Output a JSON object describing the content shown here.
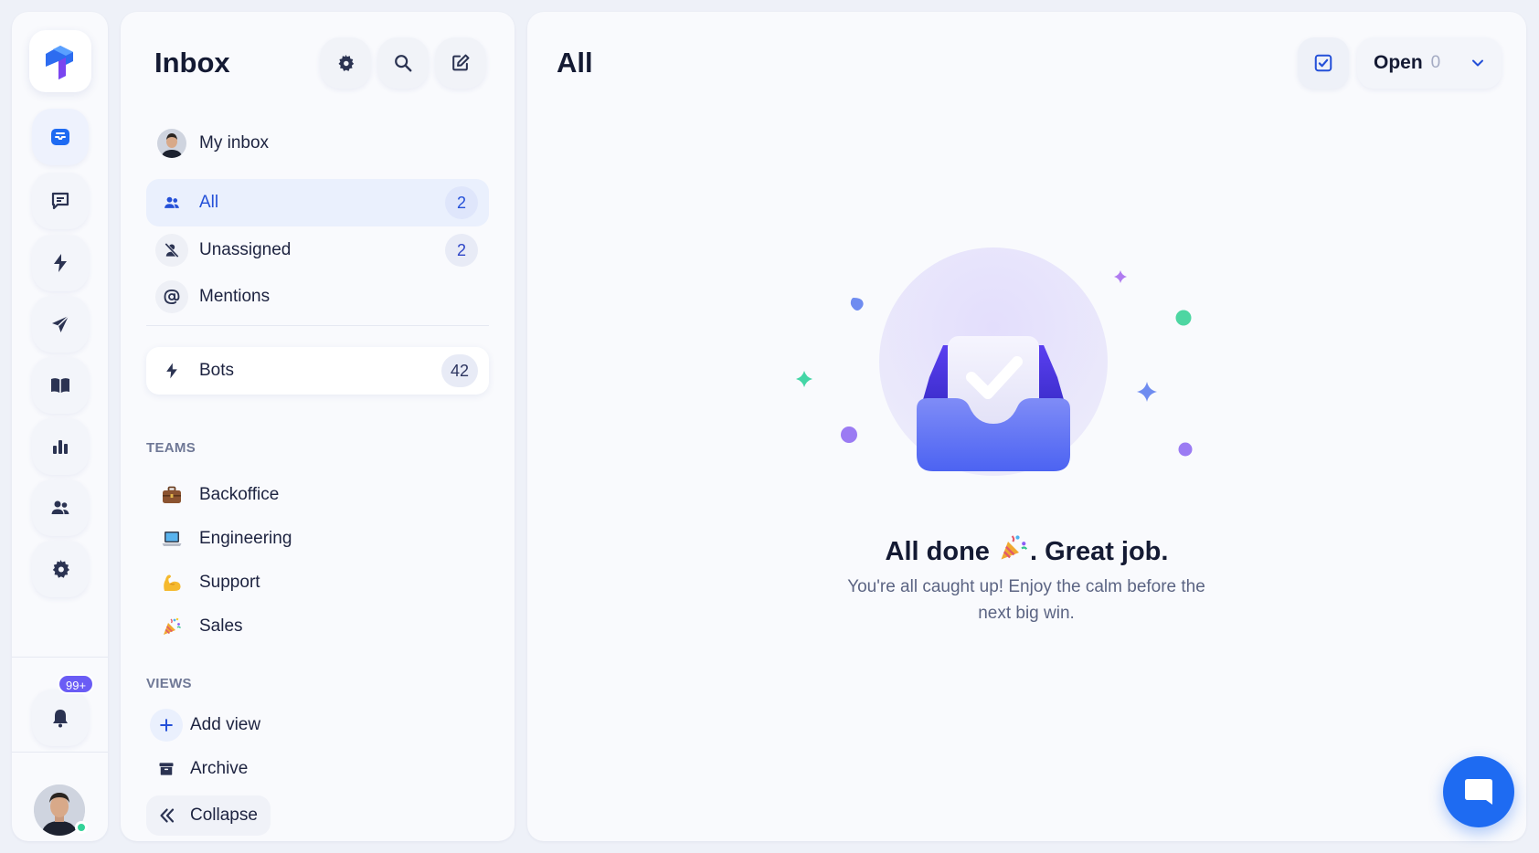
{
  "rail": {
    "items": [
      {
        "name": "inbox",
        "icon": "inbox-icon",
        "active": true
      },
      {
        "name": "chat",
        "icon": "chat-icon"
      },
      {
        "name": "automations",
        "icon": "lightning-icon"
      },
      {
        "name": "campaigns",
        "icon": "send-icon"
      },
      {
        "name": "knowledge-base",
        "icon": "book-icon"
      },
      {
        "name": "reports",
        "icon": "bar-chart-icon"
      },
      {
        "name": "contacts",
        "icon": "people-icon"
      },
      {
        "name": "settings",
        "icon": "gear-icon"
      }
    ],
    "notifications_badge": "99+"
  },
  "sidebar": {
    "title": "Inbox",
    "nav": [
      {
        "label": "My inbox",
        "count": ""
      },
      {
        "label": "All",
        "count": "2"
      },
      {
        "label": "Unassigned",
        "count": "2"
      },
      {
        "label": "Mentions",
        "count": ""
      },
      {
        "label": "Bots",
        "count": "42"
      }
    ],
    "teams_label": "TEAMS",
    "teams": [
      {
        "label": "Backoffice",
        "icon": "briefcase-icon"
      },
      {
        "label": "Engineering",
        "icon": "laptop-icon"
      },
      {
        "label": "Support",
        "icon": "flexed-biceps-icon"
      },
      {
        "label": "Sales",
        "icon": "party-popper-icon"
      }
    ],
    "views_label": "VIEWS",
    "views": [
      {
        "label": "Add view"
      },
      {
        "label": "Archive"
      }
    ],
    "collapse_label": "Collapse"
  },
  "main": {
    "title": "All",
    "status_filter": {
      "label": "Open",
      "count": "0"
    },
    "empty_state": {
      "title_before": "All done ",
      "title_after": ". Great job.",
      "subtitle": "You're all caught up! Enjoy the calm before the next big win."
    }
  },
  "colors": {
    "accent": "#2450d8",
    "brand_blue": "#1e6bf2",
    "badge_purple": "#6a5cf5",
    "online_green": "#34d399"
  }
}
